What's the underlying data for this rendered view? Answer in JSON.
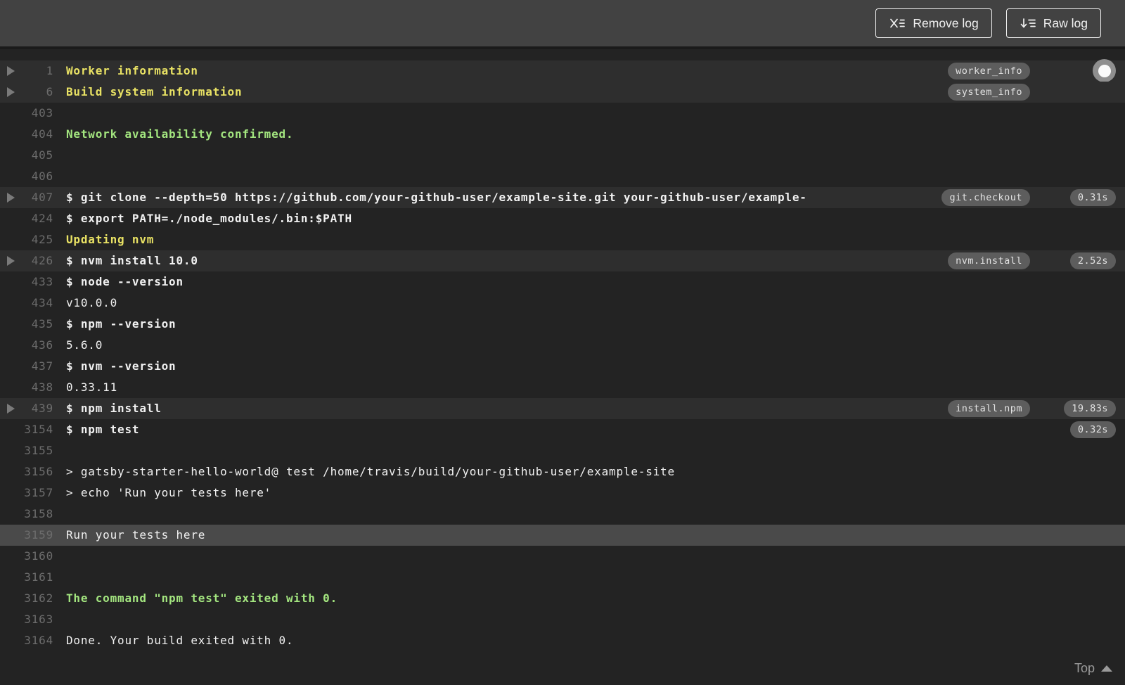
{
  "toolbar": {
    "remove_log_label": "Remove log",
    "raw_log_label": "Raw log"
  },
  "log": {
    "lines": [
      {
        "number": "1",
        "text": "Worker information",
        "style": "fold-title",
        "fold": true,
        "badge": "worker_info",
        "marker": true
      },
      {
        "number": "6",
        "text": "Build system information",
        "style": "fold-title",
        "fold": true,
        "badge": "system_info"
      },
      {
        "number": "403",
        "text": ""
      },
      {
        "number": "404",
        "text": "Network availability confirmed.",
        "style": "success"
      },
      {
        "number": "405",
        "text": ""
      },
      {
        "number": "406",
        "text": ""
      },
      {
        "number": "407",
        "text": "$ git clone --depth=50 https://github.com/your-github-user/example-site.git your-github-user/example-",
        "style": "command",
        "fold": true,
        "badge": "git.checkout",
        "time": "0.31s"
      },
      {
        "number": "424",
        "text": "$ export PATH=./node_modules/.bin:$PATH",
        "style": "command"
      },
      {
        "number": "425",
        "text": "Updating nvm",
        "style": "fold-title"
      },
      {
        "number": "426",
        "text": "$ nvm install 10.0",
        "style": "command",
        "fold": true,
        "badge": "nvm.install",
        "time": "2.52s"
      },
      {
        "number": "433",
        "text": "$ node --version",
        "style": "command"
      },
      {
        "number": "434",
        "text": "v10.0.0",
        "style": "plain"
      },
      {
        "number": "435",
        "text": "$ npm --version",
        "style": "command"
      },
      {
        "number": "436",
        "text": "5.6.0",
        "style": "plain"
      },
      {
        "number": "437",
        "text": "$ nvm --version",
        "style": "command"
      },
      {
        "number": "438",
        "text": "0.33.11",
        "style": "plain"
      },
      {
        "number": "439",
        "text": "$ npm install",
        "style": "command",
        "fold": true,
        "badge": "install.npm",
        "time": "19.83s"
      },
      {
        "number": "3154",
        "text": "$ npm test",
        "style": "command",
        "time": "0.32s"
      },
      {
        "number": "3155",
        "text": ""
      },
      {
        "number": "3156",
        "text": "> gatsby-starter-hello-world@ test /home/travis/build/your-github-user/example-site",
        "style": "plain"
      },
      {
        "number": "3157",
        "text": "> echo 'Run your tests here'",
        "style": "plain"
      },
      {
        "number": "3158",
        "text": ""
      },
      {
        "number": "3159",
        "text": "Run your tests here",
        "style": "plain",
        "highlight": true
      },
      {
        "number": "3160",
        "text": ""
      },
      {
        "number": "3161",
        "text": ""
      },
      {
        "number": "3162",
        "text": "The command \"npm test\" exited with 0.",
        "style": "success"
      },
      {
        "number": "3163",
        "text": ""
      },
      {
        "number": "3164",
        "text": "Done. Your build exited with 0.",
        "style": "plain"
      }
    ],
    "footer": {
      "top_label": "Top"
    }
  },
  "colors": {
    "topbar_bg": "#424242",
    "log_bg": "#232323",
    "fold_row_bg": "#2e2e2e",
    "highlight_row_bg": "#4a4a4a",
    "divider": "#1a1a1a",
    "text": "#f1f1f1",
    "line_number": "#6c6c6c",
    "arrow": "#7a7a7a",
    "yellow": "#e9e264",
    "green": "#a3e57f",
    "badge_bg": "#5d5d5d",
    "badge_text": "#e2e2e2",
    "button_border": "#f1f1f1",
    "footer_text": "#9a9a9a",
    "marker_ring": "#8f8f8f",
    "marker_dot": "#fafafa"
  }
}
